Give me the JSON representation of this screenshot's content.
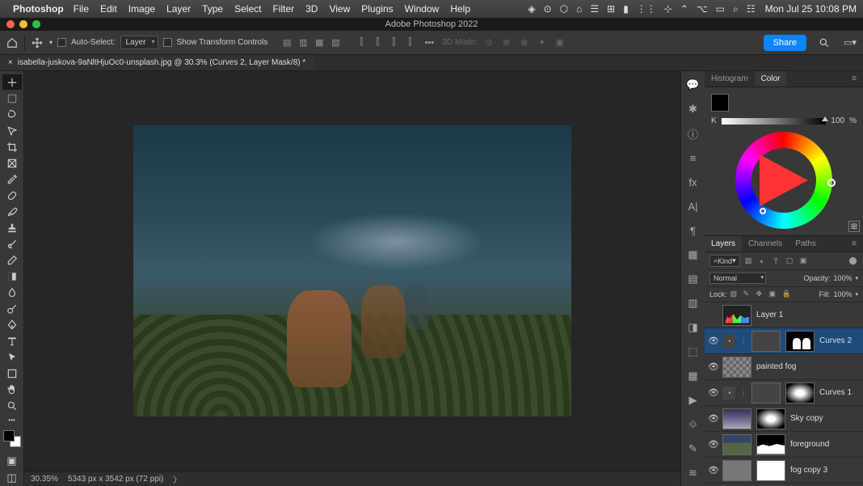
{
  "menubar": {
    "app_name": "Photoshop",
    "items": [
      "File",
      "Edit",
      "Image",
      "Layer",
      "Type",
      "Select",
      "Filter",
      "3D",
      "View",
      "Plugins",
      "Window",
      "Help"
    ],
    "clock": "Mon Jul 25  10:08 PM"
  },
  "window": {
    "title": "Adobe Photoshop 2022"
  },
  "options": {
    "auto_select_label": "Auto-Select:",
    "auto_select_target": "Layer",
    "show_transform_label": "Show Transform Controls",
    "mode_3d_label": "3D Mode:",
    "share_label": "Share"
  },
  "tab": {
    "label": "isabella-juskova-9aNltHjuOc0-unsplash.jpg @ 30.3% (Curves 2, Layer Mask/8) *"
  },
  "status": {
    "zoom": "30.35%",
    "dims": "5343 px x 3542 px (72 ppi)"
  },
  "color_panel": {
    "tabs": [
      "Histogram",
      "Color"
    ],
    "k_label": "K",
    "k_value": "100",
    "k_unit": "%"
  },
  "layers_panel": {
    "tabs": [
      "Layers",
      "Channels",
      "Paths"
    ],
    "kind_label": "Kind",
    "blend_mode": "Normal",
    "opacity_label": "Opacity:",
    "opacity_value": "100%",
    "lock_label": "Lock:",
    "fill_label": "Fill:",
    "fill_value": "100%",
    "layers": [
      {
        "name": "Layer 1",
        "visible": false,
        "thumb": "histogram",
        "mask": null,
        "adj": false
      },
      {
        "name": "Curves 2",
        "visible": true,
        "thumb": null,
        "mask": "horse",
        "adj": true,
        "selected": true
      },
      {
        "name": "painted fog",
        "visible": true,
        "thumb": "fog",
        "mask": null,
        "adj": false
      },
      {
        "name": "Curves 1",
        "visible": true,
        "thumb": null,
        "mask": "grad",
        "adj": true
      },
      {
        "name": "Sky copy",
        "visible": true,
        "thumb": "sky",
        "mask": "grad",
        "adj": false
      },
      {
        "name": "foreground",
        "visible": true,
        "thumb": "fore",
        "mask": "fore",
        "adj": false
      },
      {
        "name": "fog copy 3",
        "visible": true,
        "thumb": "gray",
        "mask": "white",
        "adj": false
      }
    ]
  }
}
